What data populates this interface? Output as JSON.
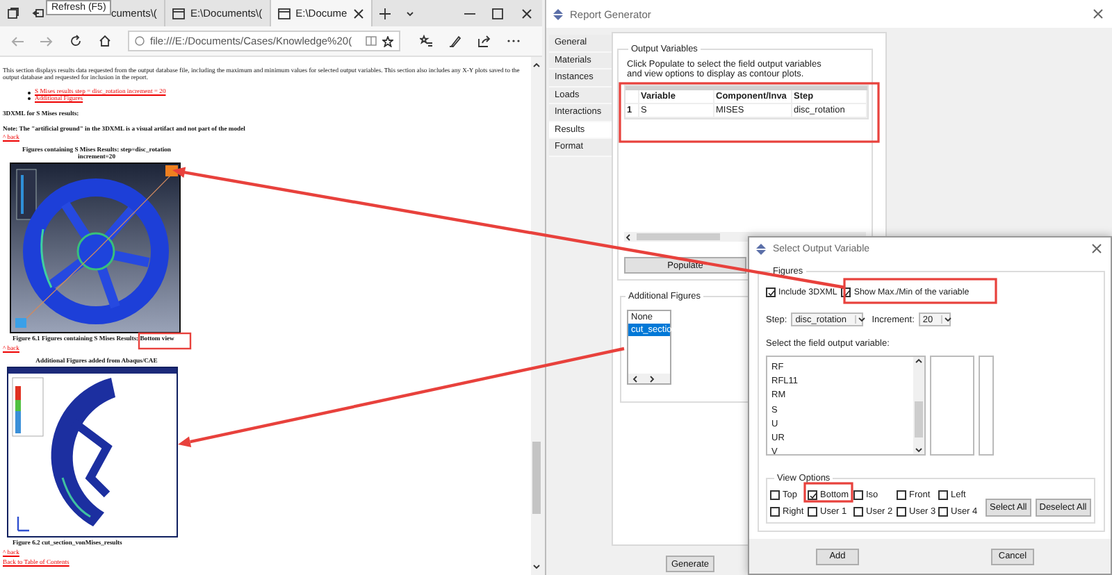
{
  "browser": {
    "tooltip": "Refresh (F5)",
    "tabs": [
      {
        "label": "cuments\\(",
        "selected": false
      },
      {
        "label": "E:\\Documents\\(",
        "selected": false
      },
      {
        "label": "E:\\Docume",
        "selected": true
      }
    ],
    "address": "file:///E:/Documents/Cases/Knowledge%20(",
    "page": [
      {
        "kind": "paragraph",
        "text": "This section displays results data requested from the output database file, including the maximum and minimum values for selected output variables. This section also includes any X-Y plots saved to the output database and requested for inclusion in the report."
      },
      {
        "kind": "links",
        "items": [
          "S Mises results step = disc_rotation increment = 20",
          "Additional Figures"
        ]
      },
      {
        "kind": "heading",
        "text": "3DXML for S Mises results:"
      },
      {
        "kind": "heading",
        "text": "Note: The \"artificial ground\" in the 3DXML is a visual artifact and not part of the model"
      },
      {
        "kind": "link",
        "text": "^ back"
      },
      {
        "kind": "title",
        "text": "Figures containing S Mises Results: step=disc_rotation increment=20"
      },
      {
        "kind": "picture"
      },
      {
        "kind": "caption",
        "text": "Figure 6.1 Figures containing S Mises Results: Bottom view"
      },
      {
        "kind": "link",
        "text": "^ back"
      },
      {
        "kind": "title",
        "text": "Additional Figures added from Abaqus/CAE"
      },
      {
        "kind": "picture"
      },
      {
        "kind": "caption",
        "text": "Figure 6.2 cut_section_vonMises_results"
      },
      {
        "kind": "link",
        "text": "^ back"
      },
      {
        "kind": "link",
        "text": "Back to Table of Contents"
      }
    ]
  },
  "report_generator": {
    "title": "Report Generator",
    "tabs": [
      {
        "label": "General",
        "selected": false
      },
      {
        "label": "Materials",
        "selected": false
      },
      {
        "label": "Instances",
        "selected": false
      },
      {
        "label": "Loads",
        "selected": false
      },
      {
        "label": "Interactions",
        "selected": false
      },
      {
        "label": "Results",
        "selected": true
      },
      {
        "label": "Format",
        "selected": false
      }
    ],
    "output_variables": {
      "title": "Output Variables",
      "hint": "Click Populate to select the field output variables and view options to display as contour plots.",
      "columns": [
        "Variable",
        "Component/Inva",
        "Step"
      ],
      "rows": [
        {
          "number": "1",
          "cells": [
            "S",
            "MISES",
            "disc_rotation"
          ]
        }
      ]
    },
    "populate": "Populate",
    "additional_figures": {
      "title": "Additional Figures",
      "items": [
        {
          "label": "None",
          "selected": false
        },
        {
          "label": "cut_sectio",
          "selected": true
        }
      ]
    },
    "generate": "Generate"
  },
  "select_dialog": {
    "title": "Select Output Variable",
    "figures": {
      "title": "Figures",
      "options": [
        {
          "label": "Include 3DXML",
          "checked": true
        },
        {
          "label": "Show Max./Min of the variable",
          "checked": true
        }
      ],
      "step_label": "Step:",
      "step": "disc_rotation",
      "increment_label": "Increment:",
      "increment": "20",
      "field_label": "Select the field output variable:",
      "variables": [
        "RF",
        "RFL11",
        "RM",
        "S",
        "U",
        "UR",
        "V"
      ],
      "view_options": {
        "title": "View Options",
        "items": [
          {
            "label": "Top",
            "checked": false
          },
          {
            "label": "Bottom",
            "checked": true
          },
          {
            "label": "Iso",
            "checked": false
          },
          {
            "label": "Front",
            "checked": false
          },
          {
            "label": "Left",
            "checked": false
          },
          {
            "label": "Right",
            "checked": false
          },
          {
            "label": "User 1",
            "checked": false
          },
          {
            "label": "User 2",
            "checked": false
          },
          {
            "label": "User 3",
            "checked": false
          },
          {
            "label": "User 4",
            "checked": false
          }
        ],
        "buttons": [
          "Select All",
          "Deselect All"
        ]
      }
    },
    "buttons": [
      "Add",
      "Cancel"
    ]
  }
}
